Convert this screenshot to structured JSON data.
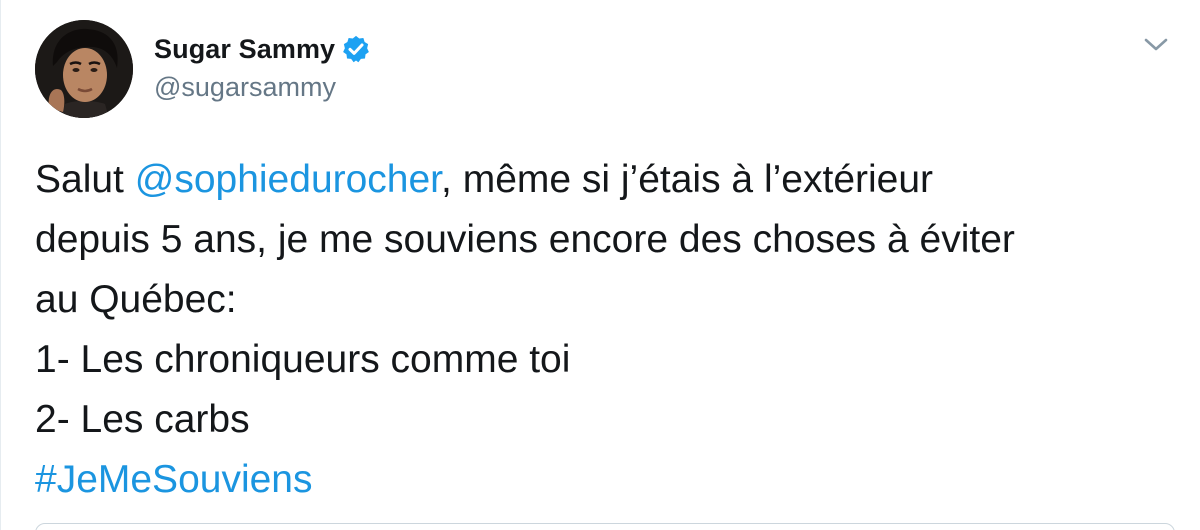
{
  "user": {
    "display_name": "Sugar Sammy",
    "handle": "@sugarsammy",
    "verified": true,
    "avatar_icon": "profile-photo"
  },
  "menu": {
    "icon": "chevron-down-icon"
  },
  "tweet": {
    "line1_prefix": "Salut ",
    "mention": "@sophiedurocher",
    "line1_suffix": ", même si j’étais à l’extérieur",
    "line2": "depuis 5 ans, je me souviens encore des choses à éviter",
    "line3": "au Québec:",
    "line4": "1- Les chroniqueurs comme toi",
    "line5": "2- Les carbs",
    "hashtag": "#JeMeSouviens"
  },
  "colors": {
    "link": "#1b95e0",
    "verified_badge": "#1da1f2",
    "handle": "#657786",
    "text": "#14171a"
  }
}
